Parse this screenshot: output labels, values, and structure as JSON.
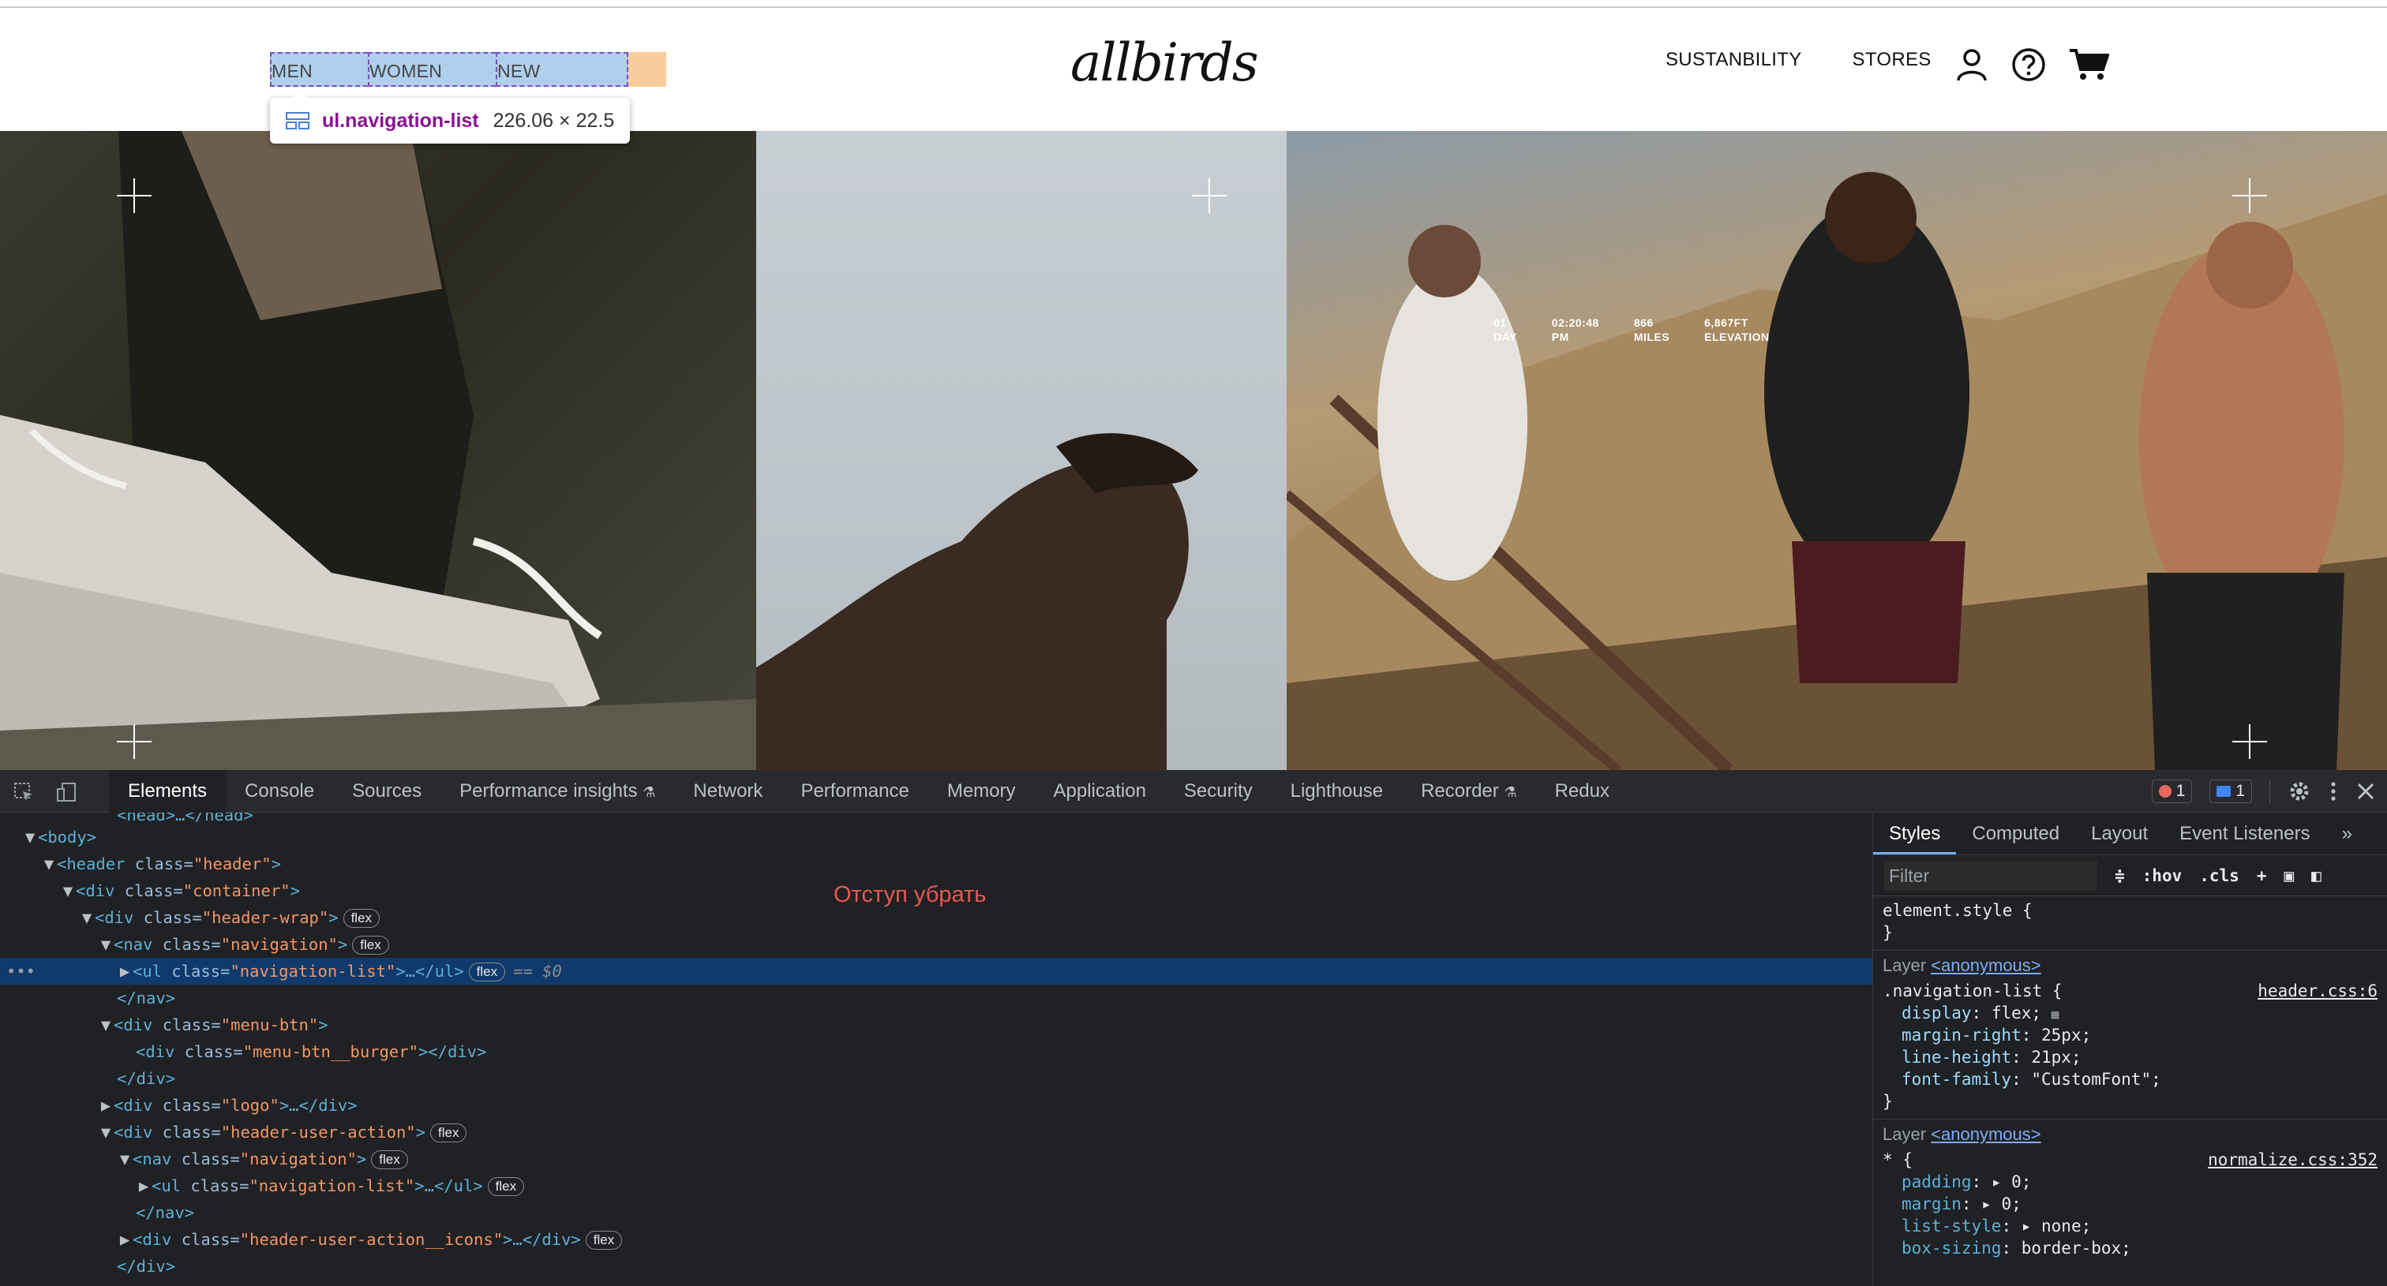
{
  "site": {
    "nav_left": [
      "MEN",
      "WOMEN",
      "NEW ARRIVALS"
    ],
    "nav_right": [
      "SUSTANBILITY",
      "STORES"
    ],
    "logo_text": "allbirds",
    "icons": [
      "user-icon",
      "help-icon",
      "cart-icon"
    ],
    "tooltip": {
      "selector": "ul.navigation-list",
      "size": "226.06 × 22.5"
    },
    "hero_stats": [
      {
        "value": "01",
        "label": "DAY"
      },
      {
        "value": "02:20:48",
        "label": "PM"
      },
      {
        "value": "866",
        "label": "MILES"
      },
      {
        "value": "6,867FT",
        "label": "ELEVATION"
      }
    ]
  },
  "devtools": {
    "tabs": [
      "Elements",
      "Console",
      "Sources",
      "Performance insights",
      "Network",
      "Performance",
      "Memory",
      "Application",
      "Security",
      "Lighthouse",
      "Recorder",
      "Redux"
    ],
    "active_tab": "Elements",
    "error_count": "1",
    "message_count": "1",
    "dom": {
      "head_partial": "<head>…</head>",
      "body": "body",
      "header_class": "header",
      "container_class": "container",
      "header_wrap_class": "header-wrap",
      "nav_class": "navigation",
      "ul_class": "navigation-list",
      "menu_btn_class": "menu-btn",
      "burger_class": "menu-btn__burger",
      "logo_class": "logo",
      "user_action_class": "header-user-action",
      "icons_class": "header-user-action__icons",
      "flex_badge": "flex",
      "selected_marker": "== $0",
      "close_nav": "</nav>",
      "close_div": "</div>"
    },
    "annotation": "Отступ убрать",
    "styles": {
      "tabs": [
        "Styles",
        "Computed",
        "Layout",
        "Event Listeners"
      ],
      "filter_placeholder": "Filter",
      "hov": ":hov",
      "cls": ".cls",
      "element_style": "element.style {",
      "close_brace": "}",
      "layer_label": "Layer",
      "layer_link": "<anonymous>",
      "rule1": {
        "selector": ".navigation-list {",
        "source": "header.css:6",
        "props": [
          {
            "name": "display",
            "value": "flex;"
          },
          {
            "name": "margin-right",
            "value": "25px;"
          },
          {
            "name": "line-height",
            "value": "21px;"
          },
          {
            "name": "font-family",
            "value": "\"CustomFont\";"
          }
        ]
      },
      "rule2": {
        "selector": "* {",
        "source": "normalize.css:352",
        "props": [
          {
            "name": "padding",
            "value": "▸ 0;"
          },
          {
            "name": "margin",
            "value": "▸ 0;"
          },
          {
            "name": "list-style",
            "value": "▸ none;"
          },
          {
            "name": "box-sizing",
            "value": "border-box;"
          }
        ]
      }
    }
  }
}
